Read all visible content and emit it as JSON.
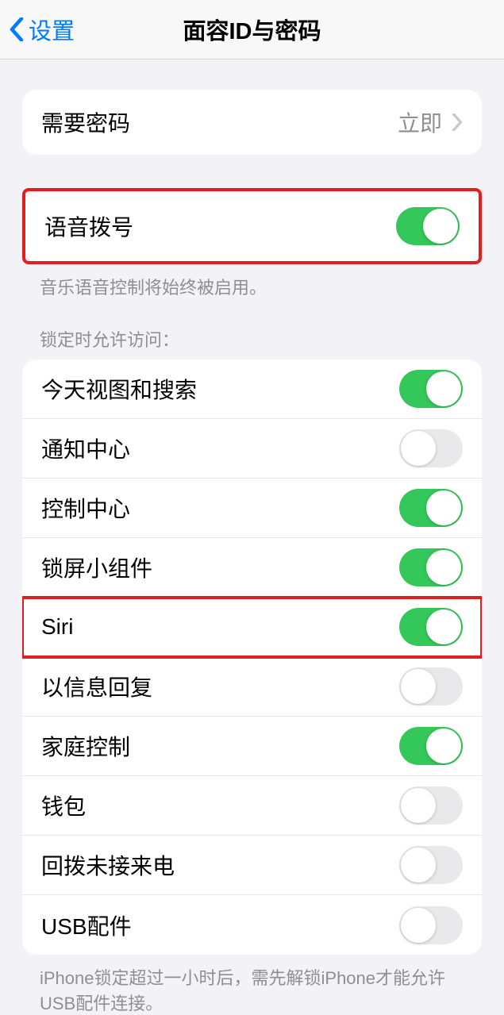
{
  "nav": {
    "back_label": "设置",
    "title": "面容ID与密码"
  },
  "passcode_section": {
    "require_label": "需要密码",
    "require_value": "立即"
  },
  "voice_section": {
    "voice_dial_label": "语音拨号",
    "voice_dial_on": true,
    "footer": "音乐语音控制将始终被启用。"
  },
  "lock_access": {
    "header": "锁定时允许访问：",
    "items": [
      {
        "label": "今天视图和搜索",
        "on": true,
        "highlight": false
      },
      {
        "label": "通知中心",
        "on": false,
        "highlight": false
      },
      {
        "label": "控制中心",
        "on": true,
        "highlight": false
      },
      {
        "label": "锁屏小组件",
        "on": true,
        "highlight": false
      },
      {
        "label": "Siri",
        "on": true,
        "highlight": true
      },
      {
        "label": "以信息回复",
        "on": false,
        "highlight": false
      },
      {
        "label": "家庭控制",
        "on": true,
        "highlight": false
      },
      {
        "label": "钱包",
        "on": false,
        "highlight": false
      },
      {
        "label": "回拨未接来电",
        "on": false,
        "highlight": false
      },
      {
        "label": "USB配件",
        "on": false,
        "highlight": false
      }
    ],
    "footer": "iPhone锁定超过一小时后，需先解锁iPhone才能允许USB配件连接。"
  }
}
